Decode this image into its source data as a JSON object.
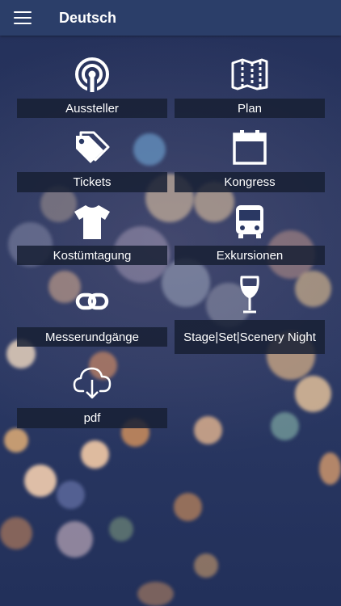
{
  "app": {
    "title": "Deutsch"
  },
  "tiles": [
    {
      "label": "Aussteller",
      "icon": "broadcast-icon"
    },
    {
      "label": "Plan",
      "icon": "map-icon"
    },
    {
      "label": "Tickets",
      "icon": "tags-icon"
    },
    {
      "label": "Kongress",
      "icon": "calendar-icon"
    },
    {
      "label": "Kostümtagung",
      "icon": "tshirt-icon"
    },
    {
      "label": "Exkursionen",
      "icon": "bus-icon"
    },
    {
      "label": "Messerundgänge",
      "icon": "link-icon"
    },
    {
      "label": "Stage|Set|Scenery Night",
      "icon": "wine-glass-icon"
    },
    {
      "label": "pdf",
      "icon": "cloud-download-icon"
    }
  ],
  "colors": {
    "topbar": "#2b3e69",
    "label_bg": "#182034",
    "text": "#ffffff"
  }
}
